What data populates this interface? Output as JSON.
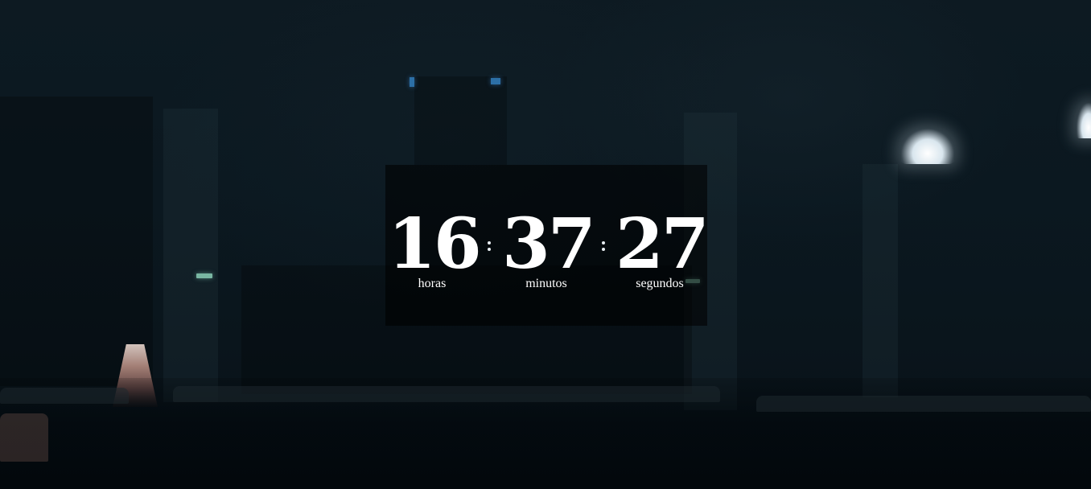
{
  "countdown": {
    "hours": {
      "value": "16",
      "label": "horas"
    },
    "minutes": {
      "value": "37",
      "label": "minutos"
    },
    "seconds": {
      "value": "27",
      "label": "segundos"
    },
    "separator_icon": "colon-dots"
  },
  "background": {
    "description_icon": "dark-auditorium-photo",
    "base_color": "#0a141c"
  }
}
